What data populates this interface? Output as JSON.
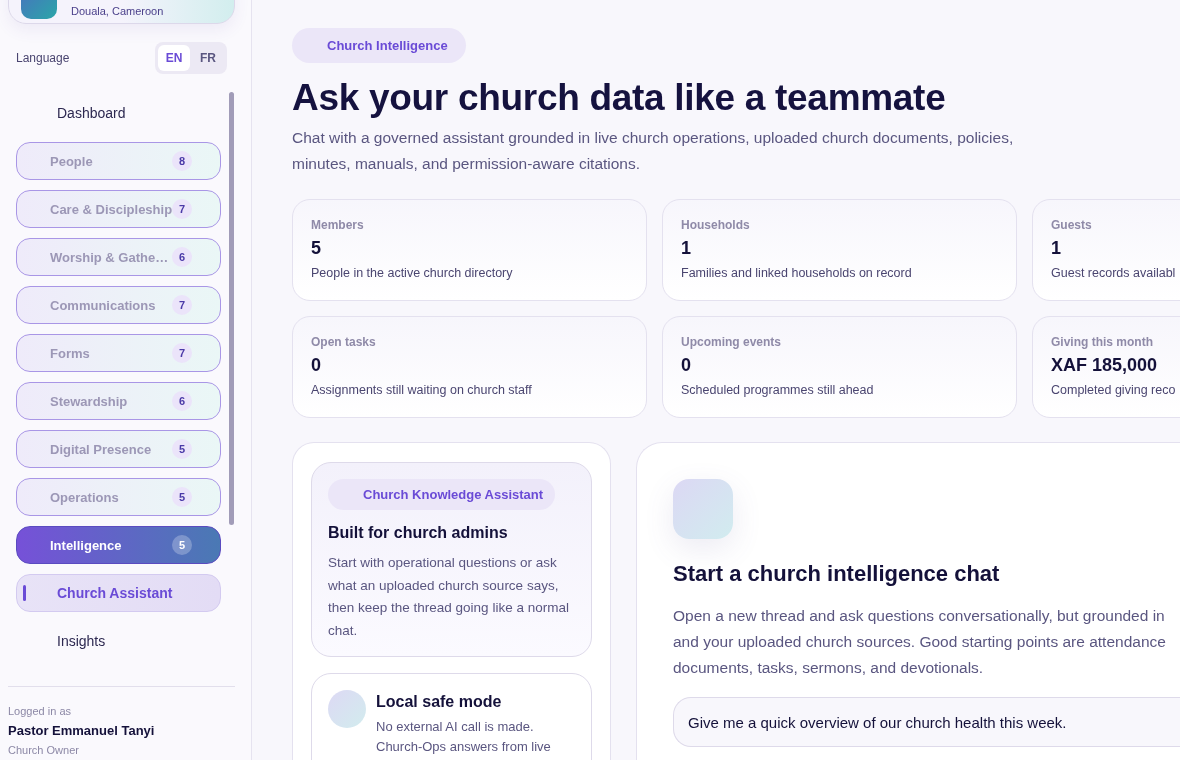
{
  "org": {
    "location": "Douala, Cameroon"
  },
  "language": {
    "label": "Language",
    "options": [
      {
        "label": "EN",
        "selected": true
      },
      {
        "label": "FR",
        "selected": false
      }
    ]
  },
  "nav": [
    {
      "kind": "link",
      "label": "Dashboard",
      "selected": false
    },
    {
      "kind": "group",
      "label": "People",
      "badge": "8",
      "selected": false
    },
    {
      "kind": "group",
      "label": "Care & Discipleship",
      "badge": "7",
      "selected": false
    },
    {
      "kind": "group",
      "label": "Worship & Gathe…",
      "badge": "6",
      "selected": false
    },
    {
      "kind": "group",
      "label": "Communications",
      "badge": "7",
      "selected": false
    },
    {
      "kind": "group",
      "label": "Forms",
      "badge": "7",
      "selected": false
    },
    {
      "kind": "group",
      "label": "Stewardship",
      "badge": "6",
      "selected": false
    },
    {
      "kind": "group",
      "label": "Digital Presence",
      "badge": "5",
      "selected": false
    },
    {
      "kind": "group",
      "label": "Operations",
      "badge": "5",
      "selected": false
    },
    {
      "kind": "group",
      "label": "Intelligence",
      "badge": "5",
      "selected": true
    },
    {
      "kind": "link",
      "label": "Church Assistant",
      "selected": true
    },
    {
      "kind": "link",
      "label": "Insights",
      "selected": false
    }
  ],
  "user": {
    "caption": "Logged in as",
    "name": "Pastor Emmanuel Tanyi",
    "role": "Church Owner"
  },
  "header": {
    "chip": "Church Intelligence",
    "title": "Ask your church data like a teammate",
    "description": "Chat with a governed assistant grounded in live church operations, uploaded church documents, policies, minutes, manuals, and permission-aware citations."
  },
  "stats": [
    {
      "label": "Members",
      "value": "5",
      "note": "People in the active church directory"
    },
    {
      "label": "Households",
      "value": "1",
      "note": "Families and linked households on record"
    },
    {
      "label": "Guests",
      "value": "1",
      "note": "Guest records availabl"
    },
    {
      "label": "Open tasks",
      "value": "0",
      "note": "Assignments still waiting on church staff"
    },
    {
      "label": "Upcoming events",
      "value": "0",
      "note": "Scheduled programmes still ahead"
    },
    {
      "label": "Giving this month",
      "value": "XAF 185,000",
      "note": "Completed giving reco"
    }
  ],
  "assistant": {
    "chip": "Church Knowledge Assistant",
    "title": "Built for church admins",
    "text": "Start with operational questions or ask what an uploaded church source says, then keep the thread going like a normal chat."
  },
  "safe_mode": {
    "title": "Local safe mode",
    "text": "No external AI call is made. Church-Ops answers from live"
  },
  "chat": {
    "title": "Start a church intelligence chat",
    "lines": [
      "Open a new thread and ask questions conversationally, but grounded in",
      "and your uploaded church sources. Good starting points are attendance",
      "documents, tasks, sermons, and devotionals."
    ],
    "prompts": [
      "Give me a quick overview of our church health this week."
    ]
  }
}
